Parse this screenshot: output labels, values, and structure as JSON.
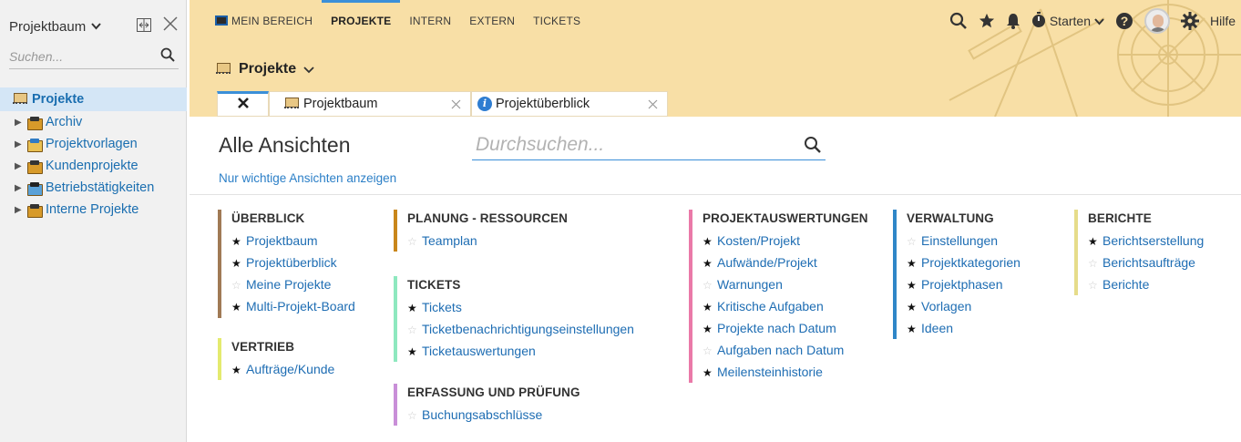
{
  "sidebar": {
    "title": "Projektbaum",
    "search_placeholder": "Suchen...",
    "tree": {
      "root": "Projekte",
      "items": [
        "Archiv",
        "Projektvorlagen",
        "Kundenprojekte",
        "Betriebstätigkeiten",
        "Interne Projekte"
      ]
    }
  },
  "nav": {
    "items": [
      "MEIN BEREICH",
      "PROJEKTE",
      "INTERN",
      "EXTERN",
      "TICKETS"
    ],
    "active": "PROJEKTE",
    "start_label": "Starten",
    "help_label": "Hilfe"
  },
  "header": {
    "title": "Projekte"
  },
  "tabs": {
    "items": [
      "Projektbaum",
      "Projektüberblick"
    ]
  },
  "main": {
    "title": "Alle Ansichten",
    "search_placeholder": "Durchsuchen...",
    "only_important_link": "Nur wichtige Ansichten anzeigen"
  },
  "groups": {
    "ueberblick": {
      "title": "ÜBERBLICK",
      "color": "#a07a55",
      "items": [
        {
          "label": "Projektbaum",
          "starred": true
        },
        {
          "label": "Projektüberblick",
          "starred": true
        },
        {
          "label": "Meine Projekte",
          "starred": false
        },
        {
          "label": "Multi-Projekt-Board",
          "starred": true
        }
      ]
    },
    "vertrieb": {
      "title": "VERTRIEB",
      "color": "#e4ea6f",
      "items": [
        {
          "label": "Aufträge/Kunde",
          "starred": true
        }
      ]
    },
    "planung": {
      "title": "PLANUNG - RESSOURCEN",
      "color": "#c9861a",
      "items": [
        {
          "label": "Teamplan",
          "starred": false
        }
      ]
    },
    "tickets": {
      "title": "TICKETS",
      "color": "#8ee8bf",
      "items": [
        {
          "label": "Tickets",
          "starred": true
        },
        {
          "label": "Ticketbenachrichtigungseinstellungen",
          "starred": false
        },
        {
          "label": "Ticketauswertungen",
          "starred": true
        }
      ]
    },
    "erfassung": {
      "title": "ERFASSUNG UND PRÜFUNG",
      "color": "#c98fd8",
      "items": [
        {
          "label": "Buchungsabschlüsse",
          "starred": false
        }
      ]
    },
    "projektauswertungen": {
      "title": "PROJEKTAUSWERTUNGEN",
      "color": "#ea79a8",
      "items": [
        {
          "label": "Kosten/Projekt",
          "starred": true
        },
        {
          "label": "Aufwände/Projekt",
          "starred": true
        },
        {
          "label": "Warnungen",
          "starred": false
        },
        {
          "label": "Kritische Aufgaben",
          "starred": true
        },
        {
          "label": "Projekte nach Datum",
          "starred": true
        },
        {
          "label": "Aufgaben nach Datum",
          "starred": false
        },
        {
          "label": "Meilensteinhistorie",
          "starred": true
        }
      ]
    },
    "verwaltung": {
      "title": "VERWALTUNG",
      "color": "#2f86c8",
      "items": [
        {
          "label": "Einstellungen",
          "starred": false
        },
        {
          "label": "Projektkategorien",
          "starred": true
        },
        {
          "label": "Projektphasen",
          "starred": true
        },
        {
          "label": "Vorlagen",
          "starred": true
        },
        {
          "label": "Ideen",
          "starred": true
        }
      ]
    },
    "berichte": {
      "title": "BERICHTE",
      "color": "#e6dc8a",
      "items": [
        {
          "label": "Berichtserstellung",
          "starred": true
        },
        {
          "label": "Berichtsaufträge",
          "starred": false
        },
        {
          "label": "Berichte",
          "starred": false
        }
      ]
    }
  }
}
